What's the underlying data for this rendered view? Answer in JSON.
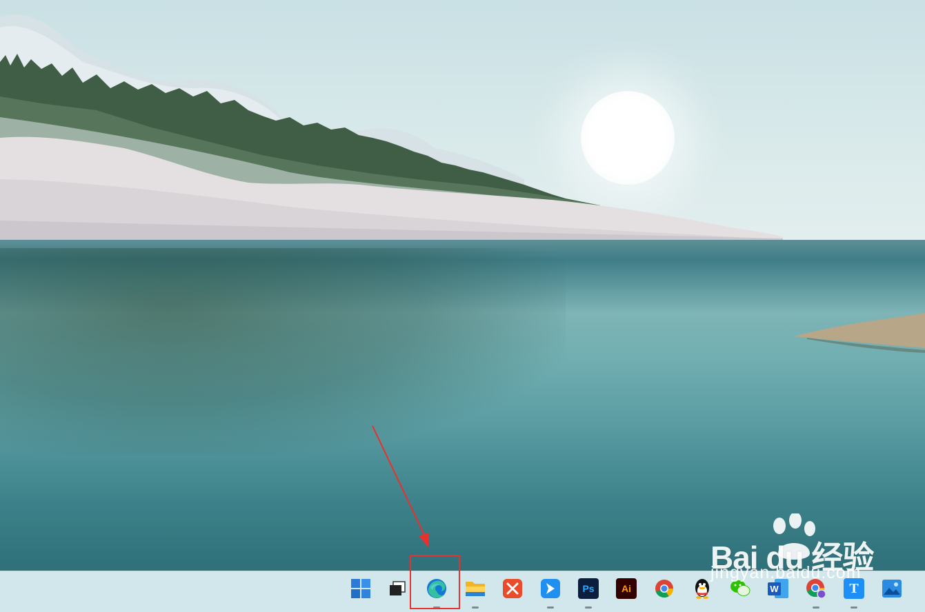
{
  "watermark": {
    "logo_text": "Bai  du 经验",
    "url_text": "jingyan.baidu.com"
  },
  "taskbar": {
    "items": [
      {
        "name": "start-button",
        "icon": "windows-logo-icon",
        "running": false
      },
      {
        "name": "task-view-button",
        "icon": "task-view-icon",
        "running": false
      },
      {
        "name": "edge-button",
        "icon": "edge-icon",
        "running": true
      },
      {
        "name": "file-explorer-button",
        "icon": "folder-icon",
        "running": true
      },
      {
        "name": "wps-button",
        "icon": "wps-icon",
        "running": false
      },
      {
        "name": "feishu-button",
        "icon": "feishu-icon",
        "running": true
      },
      {
        "name": "photoshop-button",
        "icon": "photoshop-icon",
        "label": "Ps",
        "running": true
      },
      {
        "name": "illustrator-button",
        "icon": "illustrator-icon",
        "label": "Ai",
        "running": false
      },
      {
        "name": "chrome-button",
        "icon": "chrome-icon",
        "running": false
      },
      {
        "name": "qq-button",
        "icon": "qq-penguin-icon",
        "running": false
      },
      {
        "name": "wechat-button",
        "icon": "wechat-icon",
        "running": false
      },
      {
        "name": "word-button",
        "icon": "word-icon",
        "label": "W",
        "running": false
      },
      {
        "name": "chrome-profile-button",
        "icon": "chrome-icon",
        "running": true
      },
      {
        "name": "typora-button",
        "icon": "typora-icon",
        "label": "T",
        "running": true
      },
      {
        "name": "photos-button",
        "icon": "photos-icon",
        "running": false
      }
    ]
  },
  "colors": {
    "taskbar_bg": "#d2e7ec",
    "annotation_red": "#e8312e",
    "edge_blue": "#1378d5",
    "edge_green": "#35c1a0"
  }
}
